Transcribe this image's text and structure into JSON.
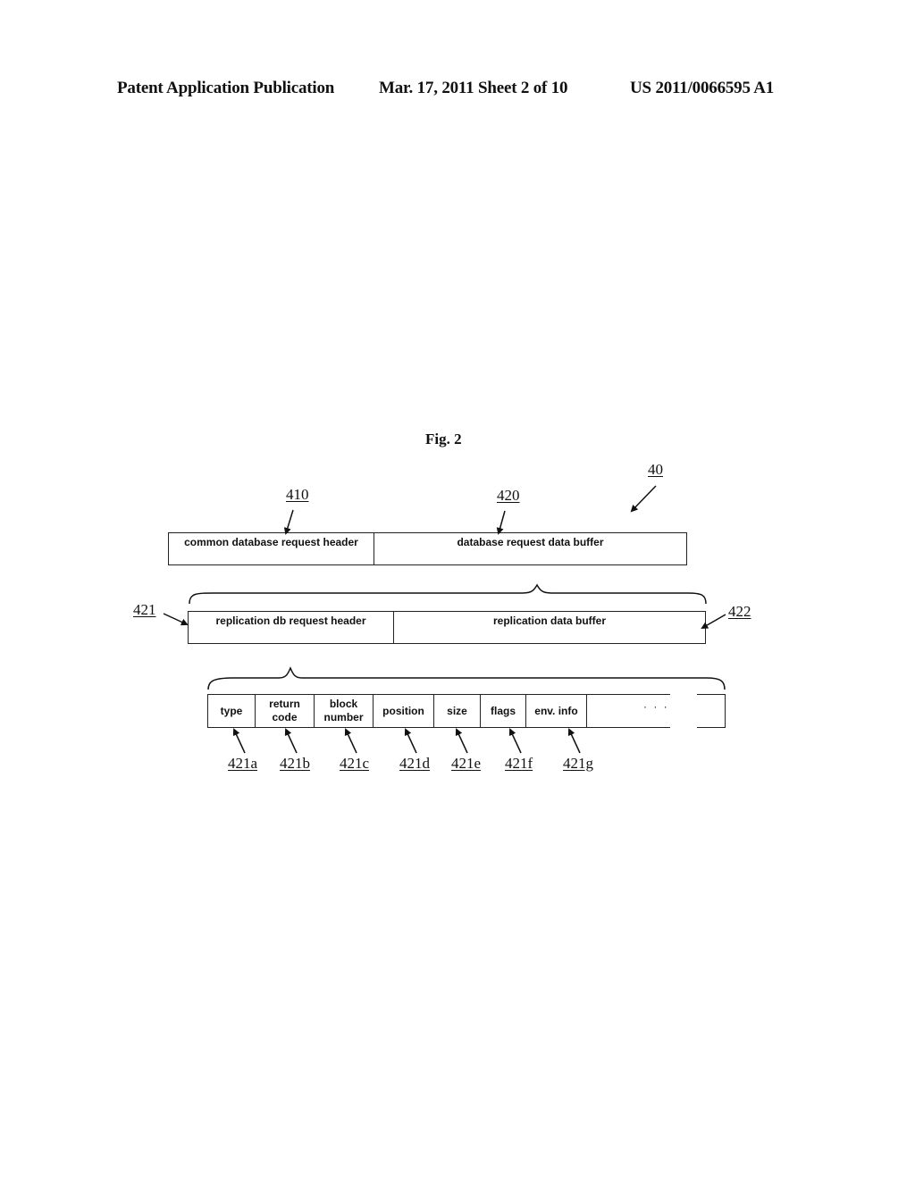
{
  "header": {
    "left": "Patent Application Publication",
    "center": "Mar. 17, 2011  Sheet 2 of 10",
    "right": "US 2011/0066595 A1"
  },
  "figure": {
    "title": "Fig. 2",
    "ref_overall": "40",
    "level1": {
      "refs": [
        "410",
        "420"
      ],
      "cells": [
        "common database request header",
        "database request data buffer"
      ]
    },
    "level2": {
      "ref_left": "421",
      "ref_right": "422",
      "cells": [
        "replication db request header",
        "replication data buffer"
      ]
    },
    "level3": {
      "cells": [
        {
          "line1": "type",
          "line2": ""
        },
        {
          "line1": "return",
          "line2": "code"
        },
        {
          "line1": "block",
          "line2": "number"
        },
        {
          "line1": "position",
          "line2": ""
        },
        {
          "line1": "size",
          "line2": ""
        },
        {
          "line1": "flags",
          "line2": ""
        },
        {
          "line1": "env. info",
          "line2": ""
        }
      ],
      "ellipsis": "· · ·",
      "refs": [
        "421a",
        "421b",
        "421c",
        "421d",
        "421e",
        "421f",
        "421g"
      ]
    }
  }
}
